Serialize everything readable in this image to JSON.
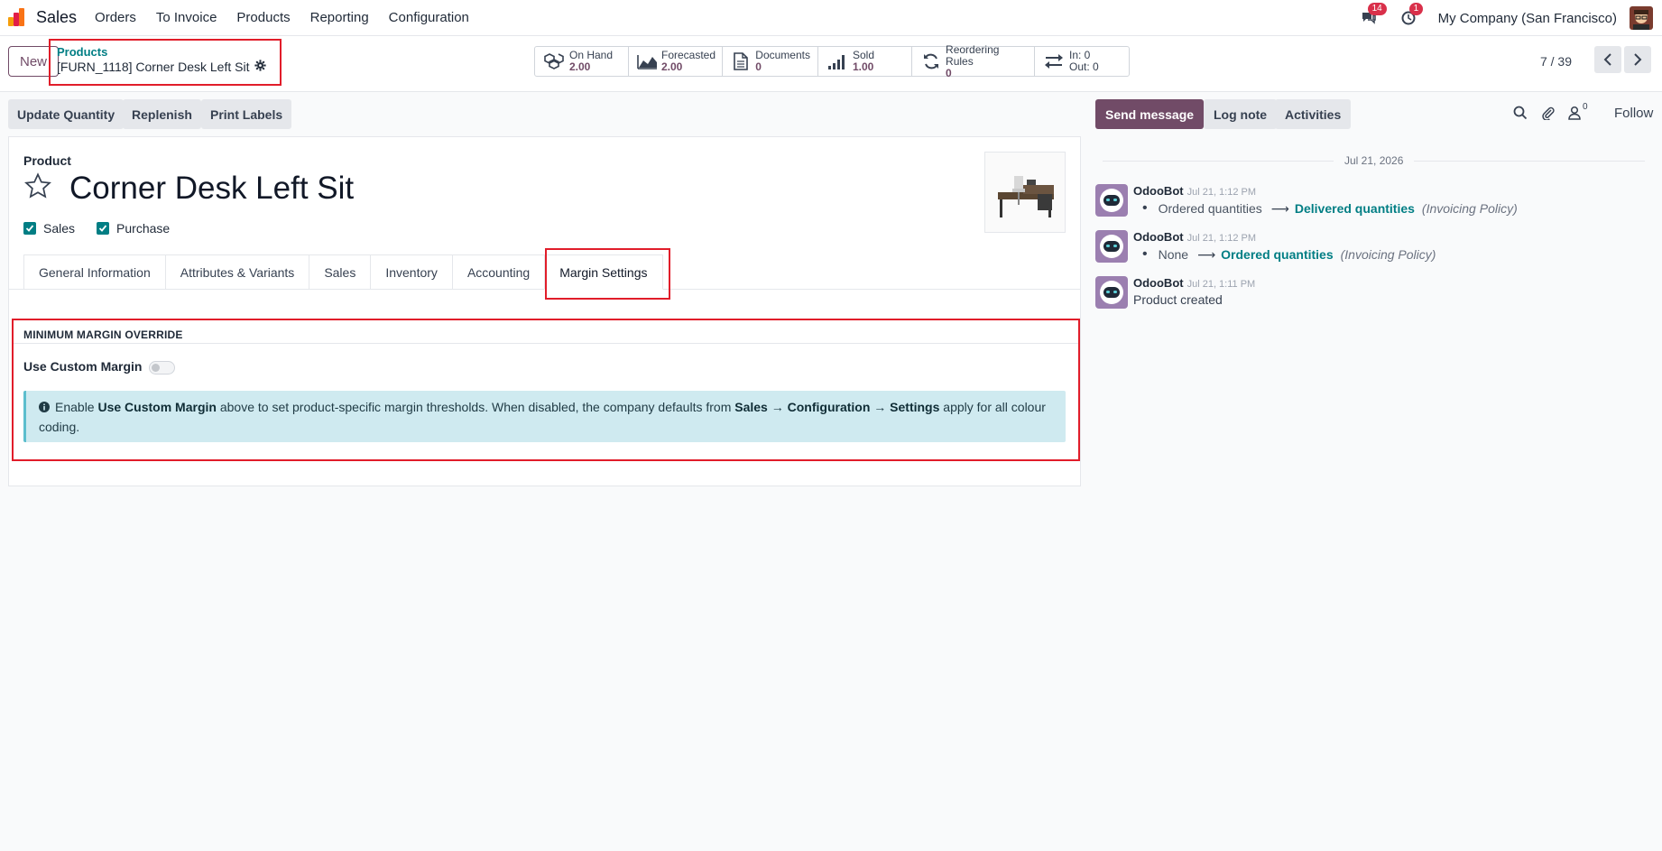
{
  "navbar": {
    "app_name": "Sales",
    "menu": [
      "Orders",
      "To Invoice",
      "Products",
      "Reporting",
      "Configuration"
    ],
    "messages_count": "14",
    "activities_count": "1",
    "company": "My Company (San Francisco)"
  },
  "control": {
    "new_label": "New",
    "breadcrumb_parent": "Products",
    "breadcrumb_current": "[FURN_1118] Corner Desk Left Sit",
    "pager": "7 / 39",
    "smart_buttons": [
      {
        "label": "On Hand",
        "value": "2.00",
        "icon": "cubes-icon"
      },
      {
        "label": "Forecasted",
        "value": "2.00",
        "icon": "area-chart-icon"
      },
      {
        "label": "Documents",
        "value": "0",
        "icon": "document-icon"
      },
      {
        "label": "Sold",
        "value": "1.00",
        "icon": "signal-icon"
      },
      {
        "label": "Reordering Rules",
        "value": "0",
        "icon": "refresh-icon"
      },
      {
        "label": "In: 0",
        "value": "Out: 0",
        "icon": "exchange-icon"
      }
    ]
  },
  "actions": {
    "update_quantity": "Update Quantity",
    "replenish": "Replenish",
    "print_labels": "Print Labels"
  },
  "form": {
    "product_label": "Product",
    "product_name": "Corner Desk Left Sit",
    "sales_label": "Sales",
    "purchase_label": "Purchase",
    "tabs": [
      "General Information",
      "Attributes & Variants",
      "Sales",
      "Inventory",
      "Accounting",
      "Margin Settings"
    ],
    "section_title": "MINIMUM MARGIN OVERRIDE",
    "custom_margin_label": "Use Custom Margin",
    "alert": {
      "t1": "Enable ",
      "b1": "Use Custom Margin",
      "t2": " above to set product-specific margin thresholds. When disabled, the company defaults from ",
      "b2": "Sales",
      "t3": " → ",
      "b3": "Configuration",
      "t4": " → ",
      "b4": "Settings",
      "t5": " apply for all colour coding."
    }
  },
  "chatter": {
    "send_message": "Send message",
    "log_note": "Log note",
    "activities": "Activities",
    "followers_count": "0",
    "follow": "Follow",
    "date": "Jul 21, 2026",
    "messages": [
      {
        "author": "OdooBot",
        "time": "Jul 21, 1:12 PM",
        "old": "Ordered quantities",
        "new": "Delivered quantities",
        "field": "(Invoicing Policy)"
      },
      {
        "author": "OdooBot",
        "time": "Jul 21, 1:12 PM",
        "old": "None",
        "new": "Ordered quantities",
        "field": "(Invoicing Policy)"
      },
      {
        "author": "OdooBot",
        "time": "Jul 21, 1:11 PM",
        "text": "Product created"
      }
    ]
  },
  "colors": {
    "primary": "#714b67",
    "accent": "#017e84",
    "highlight": "#e11d2a",
    "info_bg": "#cfeaf0"
  }
}
